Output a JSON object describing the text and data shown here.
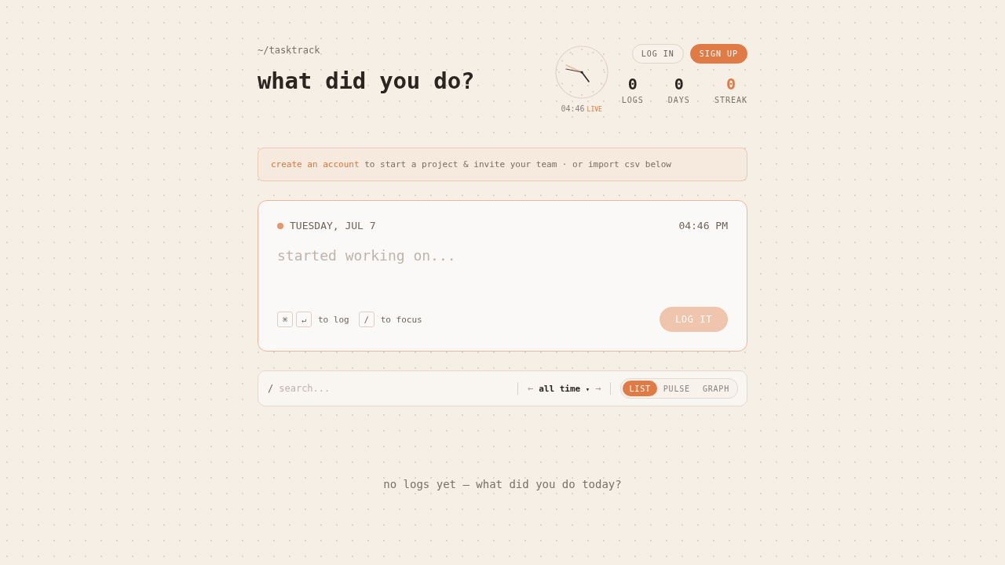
{
  "header": {
    "path": "~/tasktrack",
    "title": "what did you do?"
  },
  "clock": {
    "time": "04:46",
    "badge": "LIVE"
  },
  "auth_buttons": [
    {
      "label": "LOG IN",
      "kind": "outline"
    },
    {
      "label": "SIGN UP",
      "kind": "primary"
    }
  ],
  "stats": [
    {
      "value": "0",
      "label": "LOGS",
      "highlighted": false
    },
    {
      "value": "0",
      "label": "DAYS",
      "highlighted": false
    },
    {
      "value": "0",
      "label": "STREAK",
      "highlighted": true
    }
  ],
  "banner": {
    "link": "create an account",
    "text": "to start a project & invite your team · or import csv below"
  },
  "entry": {
    "date": "TUESDAY, JUL 7",
    "time": "04:46 PM",
    "placeholder": "started working on...",
    "hints": [
      {
        "keys": [
          "⌘",
          "↵"
        ],
        "text": "to log"
      },
      {
        "keys": [
          "/"
        ],
        "text": "to focus"
      }
    ],
    "submit": {
      "label": "LOG IT",
      "disabled": true
    }
  },
  "toolbar": {
    "search_prefix": "/",
    "search_placeholder": "search...",
    "range": {
      "prev": {
        "label": "←",
        "disabled": true
      },
      "label": "all time",
      "caret": "▾",
      "next": {
        "label": "→",
        "disabled": true
      }
    },
    "views": [
      {
        "label": "LIST",
        "selected": true
      },
      {
        "label": "PULSE",
        "selected": false
      },
      {
        "label": "GRAPH",
        "selected": false
      }
    ]
  },
  "empty_state": "no logs yet — what did you do today?"
}
